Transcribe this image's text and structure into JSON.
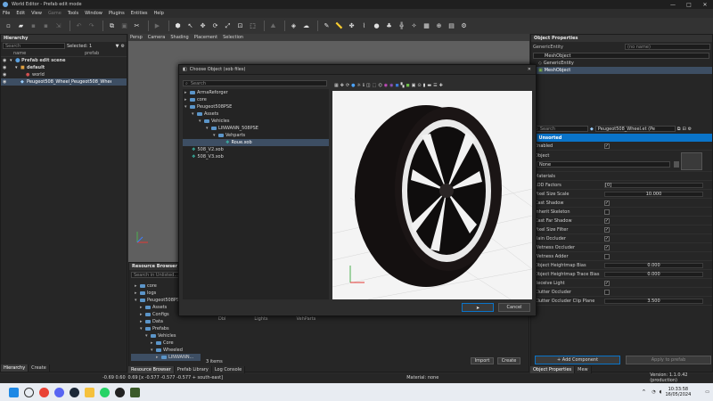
{
  "window": {
    "title": "World Editor - Prefab edit mode",
    "controls": {
      "min": "—",
      "max": "□",
      "close": "✕"
    }
  },
  "menu": [
    "File",
    "Edit",
    "View",
    "Game",
    "Tools",
    "Window",
    "Plugins",
    "Entities",
    "Help"
  ],
  "viewport_tabs": [
    "Persp",
    "Camera",
    "Shading",
    "Placement",
    "Selection"
  ],
  "hierarchy": {
    "title": "Hierarchy",
    "search_placeholder": "Search",
    "selected_label": "Selected: 1",
    "col_name": "name",
    "col_prefab": "prefab",
    "items": [
      {
        "label": "Prefab edit scene"
      },
      {
        "label": "default"
      },
      {
        "label": "world"
      },
      {
        "label": "Peugeot508_Wheel_1",
        "prefab": "Peugeot508_Wheel"
      }
    ],
    "tabs": [
      "Hierarchy",
      "Create"
    ],
    "coords": "-0.69   0.60"
  },
  "resource_browser": {
    "title": "Resource Browser",
    "search_placeholder": "Search in Unlisted...",
    "items": [
      "core",
      "logs",
      "Peugeot508PSE",
      "Assets",
      "Configs",
      "Data",
      "Prefabs",
      "Vehicles",
      "Core",
      "Wheeled",
      "LINWANN..."
    ],
    "file_items": [
      "Dbl",
      "Lights",
      "VehParts"
    ],
    "status": "3 items",
    "import_label": "Import",
    "create_label": "Create",
    "tabs": [
      "Resource Browser",
      "Prefab Library",
      "Log Console"
    ]
  },
  "status_bar": {
    "coords": "0.69 [x -0.577 -0.577 -0.577 + south-east]",
    "material": "Material: none",
    "version": "Version: 1.1.0.42 (production)"
  },
  "dialog": {
    "title": "Choose Object (xob files)",
    "close": "✕",
    "search_placeholder": "Search",
    "tree": [
      {
        "label": "ArmaReforger",
        "type": "folder"
      },
      {
        "label": "core",
        "type": "folder"
      },
      {
        "label": "Peugeot508PSE",
        "type": "folder"
      },
      {
        "label": "Assets",
        "type": "folder"
      },
      {
        "label": "Vehicles",
        "type": "folder"
      },
      {
        "label": "LINWANN_508PSE",
        "type": "folder"
      },
      {
        "label": "Vehparts",
        "type": "folder"
      },
      {
        "label": "Roue.xob",
        "type": "file"
      },
      {
        "label": "508_V2.xob",
        "type": "file"
      },
      {
        "label": "508_V3.xob",
        "type": "file"
      }
    ],
    "ok_label": "OK",
    "cancel_label": "Cancel"
  },
  "object_properties": {
    "title": "Object Properties",
    "entity_label": "GenericEntity",
    "entity_name_placeholder": "(no name)",
    "mesh_object": "MeshObject",
    "components": [
      "GenericEntity",
      "MeshObject"
    ],
    "search_placeholder": "Search",
    "selected_entity": "Peugeot508_Wheel.et (Pe",
    "section": "Unsorted",
    "enabled_label": "Enabled",
    "object_label": "Object",
    "object_value": "None",
    "props": [
      {
        "label": "Materials",
        "type": "none"
      },
      {
        "label": "LOD Factors",
        "type": "list",
        "value": "[0]"
      },
      {
        "label": "Pixel Size Scale",
        "type": "num",
        "value": "10.000"
      },
      {
        "label": "Cast Shadow",
        "type": "chk",
        "checked": true
      },
      {
        "label": "Inherit Skeleton",
        "type": "chk",
        "checked": false
      },
      {
        "label": "Cast Far Shadow",
        "type": "chk",
        "checked": true
      },
      {
        "label": "Pixel Size Filter",
        "type": "chk",
        "checked": true
      },
      {
        "label": "Rain Occluder",
        "type": "chk",
        "checked": true
      },
      {
        "label": "Wetness Occluder",
        "type": "chk",
        "checked": true
      },
      {
        "label": "Wetness Adder",
        "type": "chk",
        "checked": false
      },
      {
        "label": "Object Heightmap Bias",
        "type": "num",
        "value": "0.000"
      },
      {
        "label": "Object Heightmap Trace Bias",
        "type": "num",
        "value": "0.000"
      },
      {
        "label": "Receive Light",
        "type": "chk",
        "checked": true
      },
      {
        "label": "Clutter Occluder",
        "type": "chk",
        "checked": false
      },
      {
        "label": "Clutter Occluder Clip Plane",
        "type": "num",
        "value": "3.500"
      }
    ],
    "add_component_label": "+ Add Component",
    "apply_label": "Apply to prefab",
    "tabs": [
      "Object Properties",
      "Mew"
    ]
  },
  "taskbar": {
    "time": "10:33:58",
    "date": "16/05/2024"
  },
  "colors": {
    "accent": "#0a74c9",
    "selection": "#3d4e63"
  }
}
